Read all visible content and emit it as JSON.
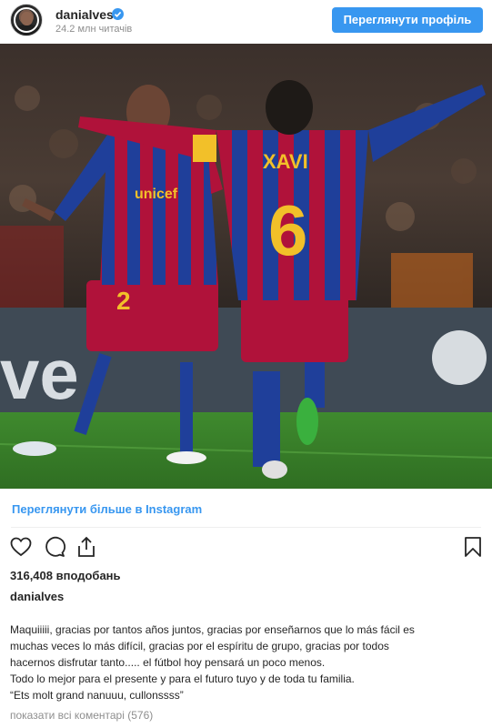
{
  "header": {
    "username": "danialves",
    "followers": "24.2 млн читачів",
    "profile_button": "Переглянути профіль"
  },
  "photo": {
    "jersey_sponsor": "unicef",
    "player_left_number": "2",
    "player_right_name": "XAVI",
    "player_right_number": "6",
    "board_text": "ve"
  },
  "more_link": "Переглянути більше в Instagram",
  "icons": {
    "like": "heart-icon",
    "comment": "comment-icon",
    "share": "share-icon",
    "save": "bookmark-icon",
    "verified": "verified-badge-icon"
  },
  "likes": "316,408 вподобань",
  "post_username": "danialves",
  "caption_lines": [
    "Maquiiiii, gracias por tantos años juntos, gracias por enseñarnos que lo más fácil es",
    "muchas veces lo más difícil, gracias por el espíritu de grupo, gracias por todos",
    "hacernos disfrutar tanto..... el fútbol hoy pensará un poco menos.",
    "Todo lo mejor para el presente y para el futuro tuyo y de toda tu familia.",
    "“Ets molt grand nanuuu, cullonssss”"
  ],
  "comments_link": "показати всі коментарі (576)",
  "colors": {
    "accent": "#3897f0",
    "text": "#262626",
    "muted": "#8e8e8e",
    "jersey_blue": "#1f3f9a",
    "jersey_red": "#b0123a"
  }
}
